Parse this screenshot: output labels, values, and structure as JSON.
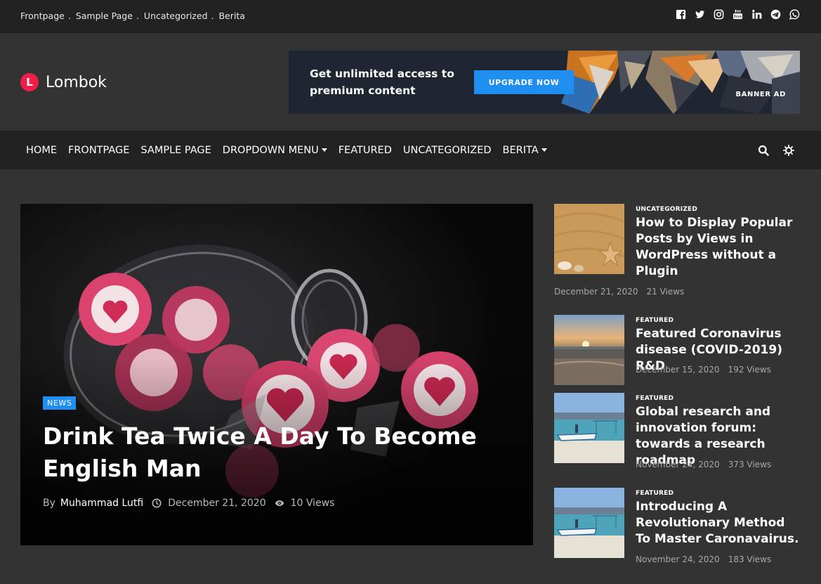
{
  "topbar": {
    "links": [
      "Frontpage",
      "Sample Page",
      "Uncategorized",
      "Berita"
    ],
    "separator": ".",
    "social_icons": [
      "facebook-icon",
      "twitter-icon",
      "instagram-icon",
      "youtube-icon",
      "linkedin-icon",
      "telegram-icon",
      "whatsapp-icon"
    ]
  },
  "header": {
    "logo_letter": "L",
    "site_name": "Lombok",
    "banner": {
      "text": "Get unlimited access to premium content",
      "button": "UPGRADE NOW",
      "tag": "BANNER AD"
    }
  },
  "nav": {
    "items": [
      {
        "label": "HOME",
        "dropdown": false
      },
      {
        "label": "FRONTPAGE",
        "dropdown": false
      },
      {
        "label": "SAMPLE PAGE",
        "dropdown": false
      },
      {
        "label": "DROPDOWN MENU",
        "dropdown": true
      },
      {
        "label": "FEATURED",
        "dropdown": false
      },
      {
        "label": "UNCATEGORIZED",
        "dropdown": false
      },
      {
        "label": "BERITA",
        "dropdown": true
      }
    ],
    "tools": [
      "search-icon",
      "theme-toggle-icon"
    ]
  },
  "hero": {
    "category": "NEWS",
    "title": "Drink Tea Twice A Day To Become English Man",
    "by": "By",
    "author": "Muhammad Lutfi",
    "date": "December 21, 2020",
    "views": "10 Views"
  },
  "sidebar": {
    "posts": [
      {
        "category": "UNCATEGORIZED",
        "title": "How to Display Popular Posts by Views in WordPress without a Plugin",
        "date": "December 21, 2020",
        "views": "21 Views"
      },
      {
        "category": "FEATURED",
        "title": "Featured Coronavirus disease (COVID-2019) R&D",
        "date": "December 15, 2020",
        "views": "192 Views"
      },
      {
        "category": "FEATURED",
        "title": "Global research and innovation forum: towards a research roadmap",
        "date": "November 24, 2020",
        "views": "373 Views"
      },
      {
        "category": "FEATURED",
        "title": "Introducing A Revolutionary Method To Master Caronavairus.",
        "date": "November 24, 2020",
        "views": "183 Views"
      }
    ]
  },
  "colors": {
    "page_bg": "#333333",
    "bar_bg": "#222222",
    "accent_red": "#ef1f4b",
    "accent_blue": "#1e8ef0"
  }
}
